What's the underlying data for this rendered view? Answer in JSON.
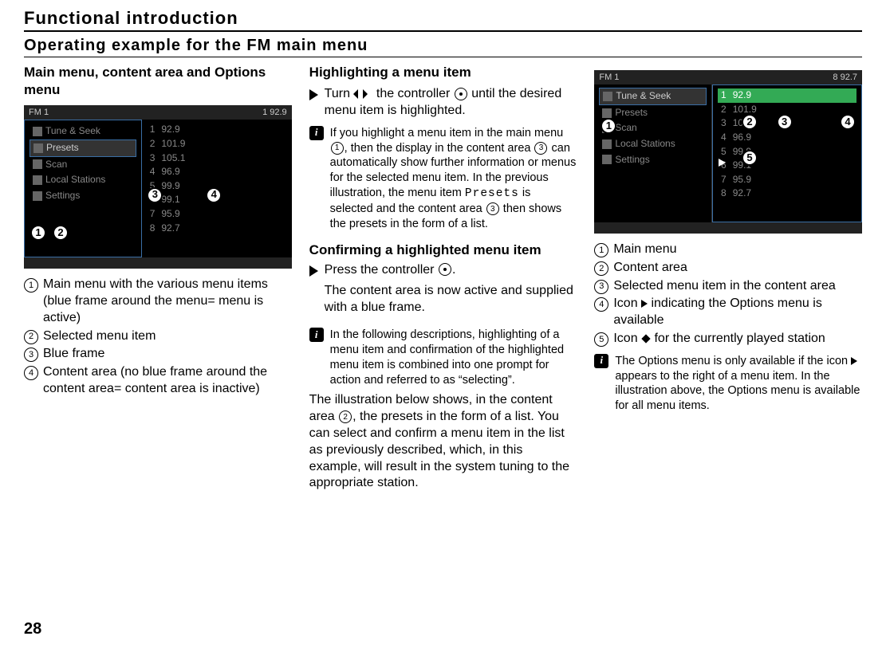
{
  "chapter": "Functional introduction",
  "section": "Operating example for the FM main menu",
  "page_number": "28",
  "col1": {
    "heading": "Main menu, content area and Options menu",
    "screenshot": {
      "title": "FM 1",
      "freq_header": "1  92.9",
      "menu": [
        "Tune & Seek",
        "Presets",
        "Scan",
        "Local Stations",
        "Settings"
      ],
      "selected_index": 1,
      "presets": [
        {
          "n": "1",
          "v": "92.9"
        },
        {
          "n": "2",
          "v": "101.9"
        },
        {
          "n": "3",
          "v": "105.1"
        },
        {
          "n": "4",
          "v": "96.9"
        },
        {
          "n": "5",
          "v": "99.9"
        },
        {
          "n": "6",
          "v": "99.1"
        },
        {
          "n": "7",
          "v": "95.9"
        },
        {
          "n": "8",
          "v": "92.7"
        }
      ],
      "markers": {
        "1": "1",
        "2": "2",
        "3": "3",
        "4": "4"
      }
    },
    "legend": {
      "1": "Main menu with the various menu items (blue frame around the menu= menu is active)",
      "2": "Selected menu item",
      "3": "Blue frame",
      "4": "Content area (no blue frame around the content area= content area is inactive)"
    }
  },
  "col2": {
    "heading_a": "Highlighting a menu item",
    "step_a_pre": "Turn ",
    "step_a_mid": " the controller ",
    "step_a_post": " until the desired menu item is highlighted.",
    "info_a_pre": "If you highlight a menu item in the main menu ",
    "info_a_mid1": ", then the display in the content area ",
    "info_a_mid2": " can automatically show further information or menus for the selected menu item. In the previous illustration, the menu item ",
    "info_a_presets": "Presets",
    "info_a_mid3": " is selected and the content area ",
    "info_a_post": " then shows the presets in the form of a list.",
    "heading_b": "Confirming a highlighted menu item",
    "step_b_pre": "Press the controller ",
    "step_b_post": ".",
    "step_b_result": "The content area is now active and supplied with a blue frame.",
    "info_b": "In the following descriptions, highlighting of a menu item and confirmation of the highlighted menu item is combined into one prompt for action and referred to as “selecting”.",
    "para_pre": "The illustration below shows, in the content area ",
    "para_post": ", the presets in the form of a list. You can select and confirm a menu item in the list as previously described, which, in this example, will result in the system tuning to the appropriate station."
  },
  "col3": {
    "screenshot": {
      "title": "FM 1",
      "freq_header": "8  92.7",
      "menu": [
        "Tune & Seek",
        "Presets",
        "Scan",
        "Local Stations",
        "Settings"
      ],
      "selected_index": 0,
      "presets": [
        {
          "n": "1",
          "v": "92.9",
          "hl": true
        },
        {
          "n": "2",
          "v": "101.9"
        },
        {
          "n": "3",
          "v": "105.1"
        },
        {
          "n": "4",
          "v": "96.9"
        },
        {
          "n": "5",
          "v": "99.9"
        },
        {
          "n": "6",
          "v": "99.1"
        },
        {
          "n": "7",
          "v": "95.9"
        },
        {
          "n": "8",
          "v": "92.7"
        }
      ],
      "markers": {
        "1": "1",
        "2": "2",
        "3": "3",
        "4": "4",
        "5": "5"
      }
    },
    "legend": {
      "1": "Main menu",
      "2": "Content area",
      "3": "Selected menu item in the content area",
      "4_pre": "Icon ",
      "4_post": " indicating the Options menu is available",
      "5_pre": "Icon ",
      "5_post": " for the currently played station"
    },
    "info_pre": "The Options menu is only available if the icon ",
    "info_post": " appears to the right of a menu item. In the illustration above, the Options menu is available for all menu items."
  }
}
